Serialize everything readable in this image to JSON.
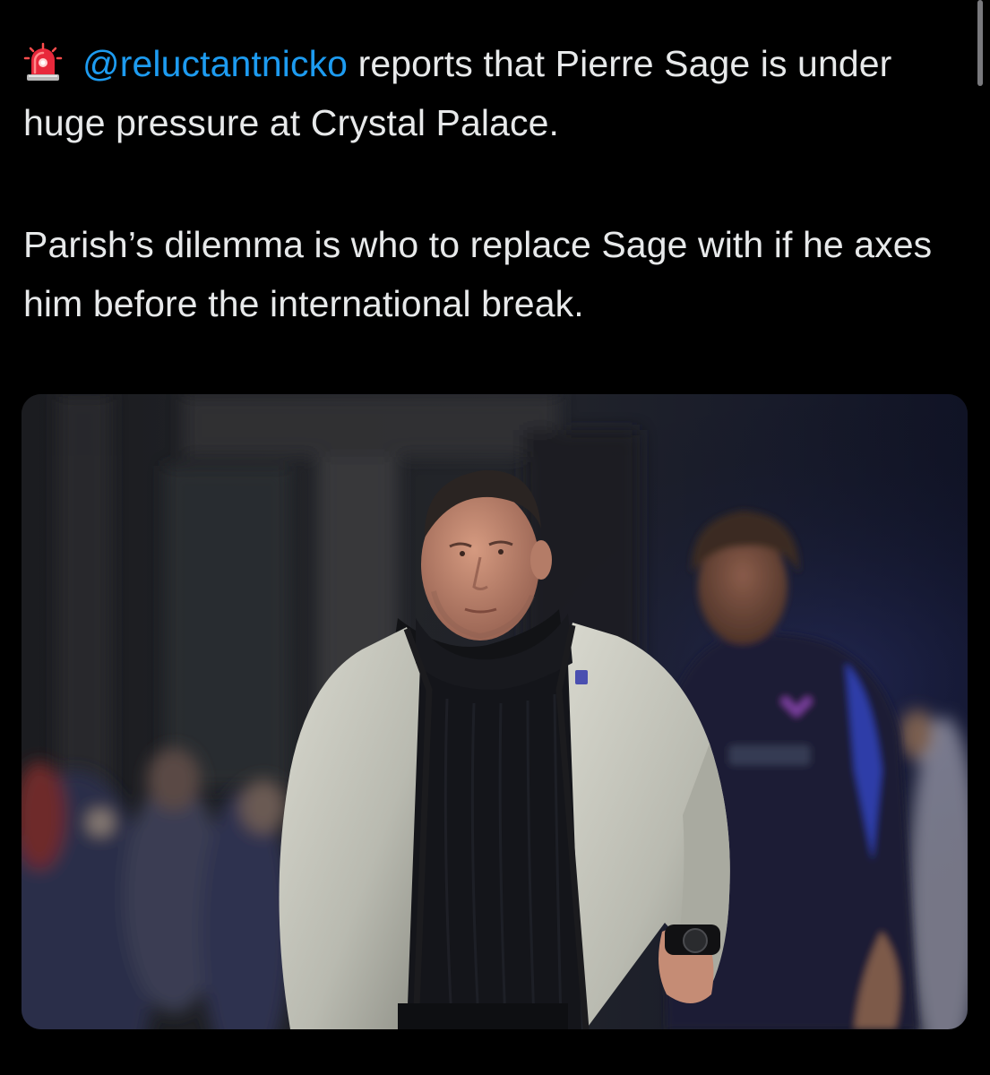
{
  "tweet": {
    "alert_icon": "police-siren-icon",
    "mention": "@reluctantnicko",
    "line1_rest": " reports that Pierre Sage is under huge pressure at Crystal Palace.",
    "paragraph2": "Parish’s dilemma is who to replace Sage with if he axes him before the international break."
  },
  "media": {
    "icon": "photo",
    "kind": "photo of a man in a cream jacket walking on a football pitch"
  },
  "colors": {
    "background": "#000000",
    "text": "#e7e9ea",
    "mention": "#1d9bf0"
  }
}
